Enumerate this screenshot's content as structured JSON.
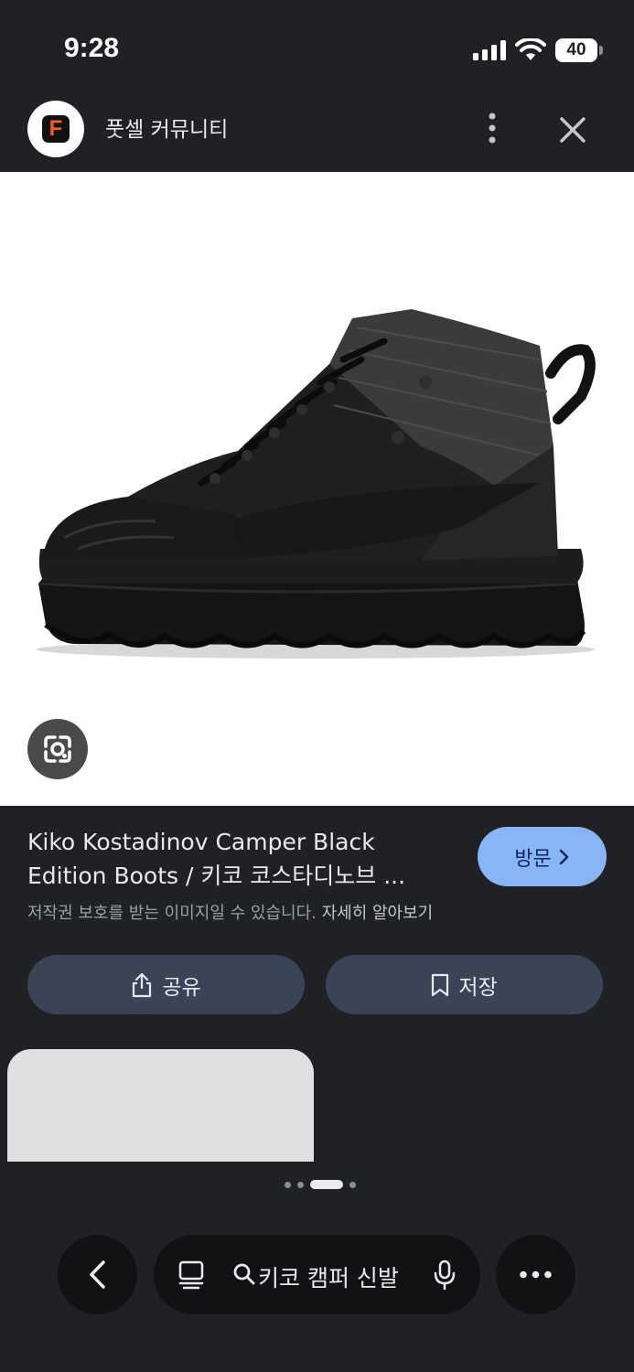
{
  "status_bar": {
    "time": "9:28",
    "battery_level": "40",
    "icons": [
      "signal-icon",
      "wifi-icon",
      "battery-icon"
    ]
  },
  "header": {
    "site_logo_letter": "F",
    "site_name": "풋셀 커뮤니티",
    "icons": [
      "more-vertical-icon",
      "close-icon"
    ]
  },
  "image": {
    "subject": "black hiking boot",
    "lens_icon": "google-lens-icon"
  },
  "result": {
    "title_line1": "Kiko Kostadinov Camper Black",
    "title_line2": "Edition Boots / 키코 코스타디노브 ...",
    "visit_label": "방문",
    "copyright_text": "저작권 보호를 받는 이미지일 수 있습니다.",
    "learn_more": "자세히 알아보기"
  },
  "actions": {
    "share_label": "공유",
    "save_label": "저장"
  },
  "pager": {
    "count": 4,
    "active_index": 2
  },
  "bottom_bar": {
    "search_query": "키코 캠퍼 신발",
    "icons": [
      "back-icon",
      "tabs-icon",
      "search-icon",
      "mic-icon",
      "more-horizontal-icon"
    ]
  },
  "colors": {
    "background": "#202124",
    "visit_button": "#8ab4f8",
    "action_button": "#394457",
    "logo_accent": "#ff5a1f"
  }
}
